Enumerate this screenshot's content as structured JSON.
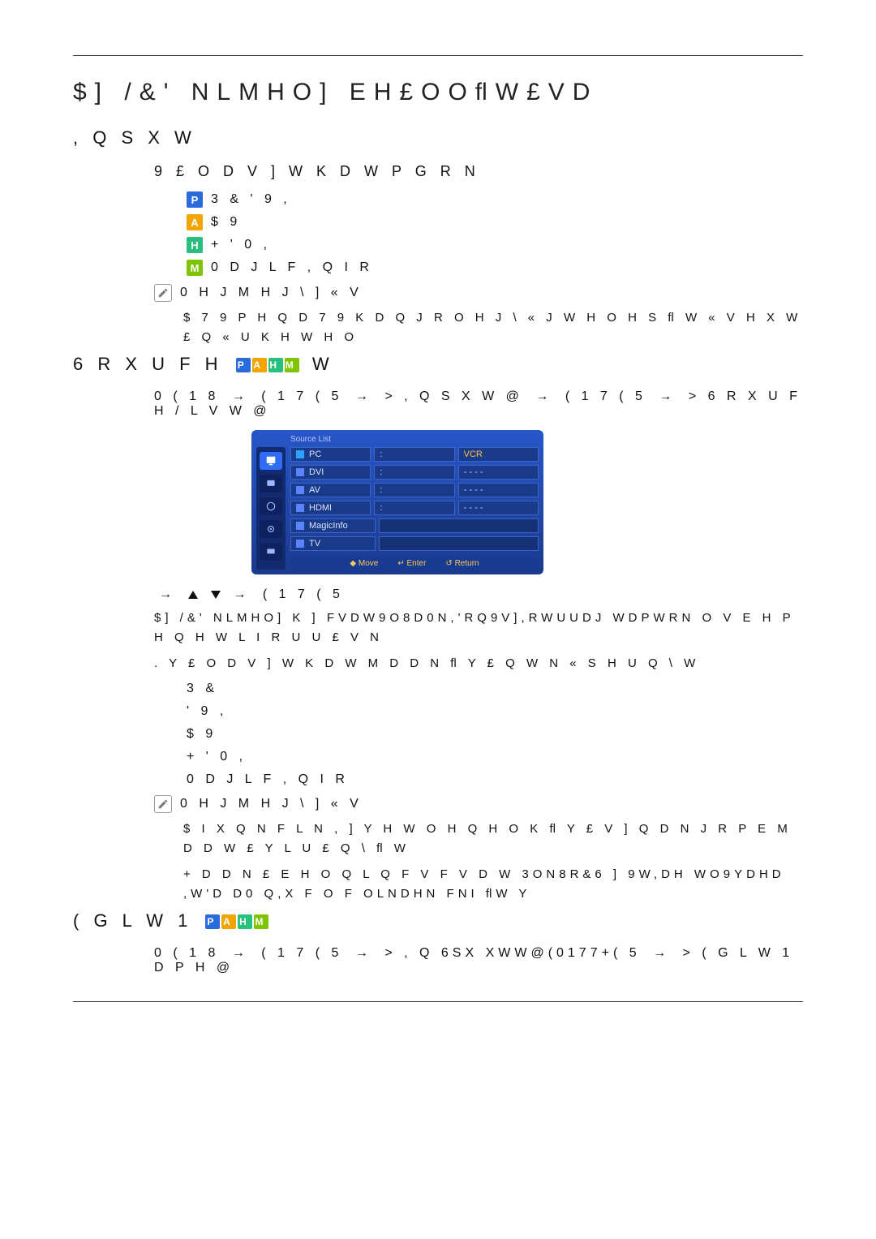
{
  "page_title": "$] /&' NLMHO]  EH£OOﬂW£VD",
  "sections": {
    "input": {
      "heading": ", Q S X W",
      "subhead": "9 £ O D V ] W K D W   P  G R N",
      "modes": {
        "pc": "3 &     ' 9 ,",
        "av": "$ 9",
        "hdmi": "+ ' 0 ,",
        "magicinfo": "0 D J L F , Q I R"
      },
      "note_label": "0 H J M H J \\ ] « V",
      "note_body": "$  7 9  P H Q   D  7 9  K D Q J R O  H J \\ « J  W H O H S ﬂ W « V H  X W £ Q  « U K H W   H O"
    },
    "sourcelist": {
      "heading_left": "6 R X U F H",
      "heading_right": "W",
      "path": {
        "a": "0 ( 1 8",
        "b": "( 1 7 ( 5",
        "c": "> , Q S X W @",
        "d": "( 1 7 ( 5",
        "e": "> 6 R X U F H  / L V W @"
      },
      "nav_enter": "( 1 7 ( 5",
      "para1": "$] /&' NLMHO]  K ] FVDW9O8D0N,'RQ9V],RWUUDJ WDPWRN   O V   E H P H Q H W L  I R U U £ V  N",
      "para2": ". Y £ O D V ] W K D W M D   D   N ﬂ Y £ Q W   N « S H U Q \\   W",
      "modes": {
        "pc": "3 &",
        "dvi": "' 9 ,",
        "av": "$ 9",
        "hdmi": "+ ' 0 ,",
        "magicinfo": "0 D J L F , Q I R"
      },
      "note_label": "0 H J M H J \\ ] « V",
      "note_line1": "$  I X Q N F L   N , ] Y H W O H Q   H O  K ﬂ Y £ V ] Q D N  J R P E M D  D  W £ Y L U £ Q \\ ﬂ W",
      "note_line2": "+ D   D  N £ E H O  Q L Q F V  F V D W 3ON8R&6 ] 9W,DH WO9YDHD ,W'D D0 Q,X F O F OLNDHN FNI ﬂW Y"
    },
    "editname": {
      "heading_left": "( G L W  1",
      "path": {
        "a": "0 ( 1 8",
        "b": "( 1 7 ( 5",
        "c": "> , Q 6SX XWW@(0177+( 5",
        "d": "> ( G L W  1 D P H @"
      }
    }
  },
  "osd": {
    "title": "Source List",
    "items": {
      "pc": "PC",
      "vcr": "VCR",
      "dvi": "DVI",
      "av": "AV",
      "hdmi": "HDMI",
      "magicinfo": "MagicInfo",
      "tv": "TV"
    },
    "dots": ":",
    "dashes": "- - - -",
    "footer": {
      "move": "Move",
      "enter": "Enter",
      "return": "Return"
    }
  },
  "badges": {
    "p": "P",
    "a": "A",
    "h": "H",
    "m": "M"
  }
}
